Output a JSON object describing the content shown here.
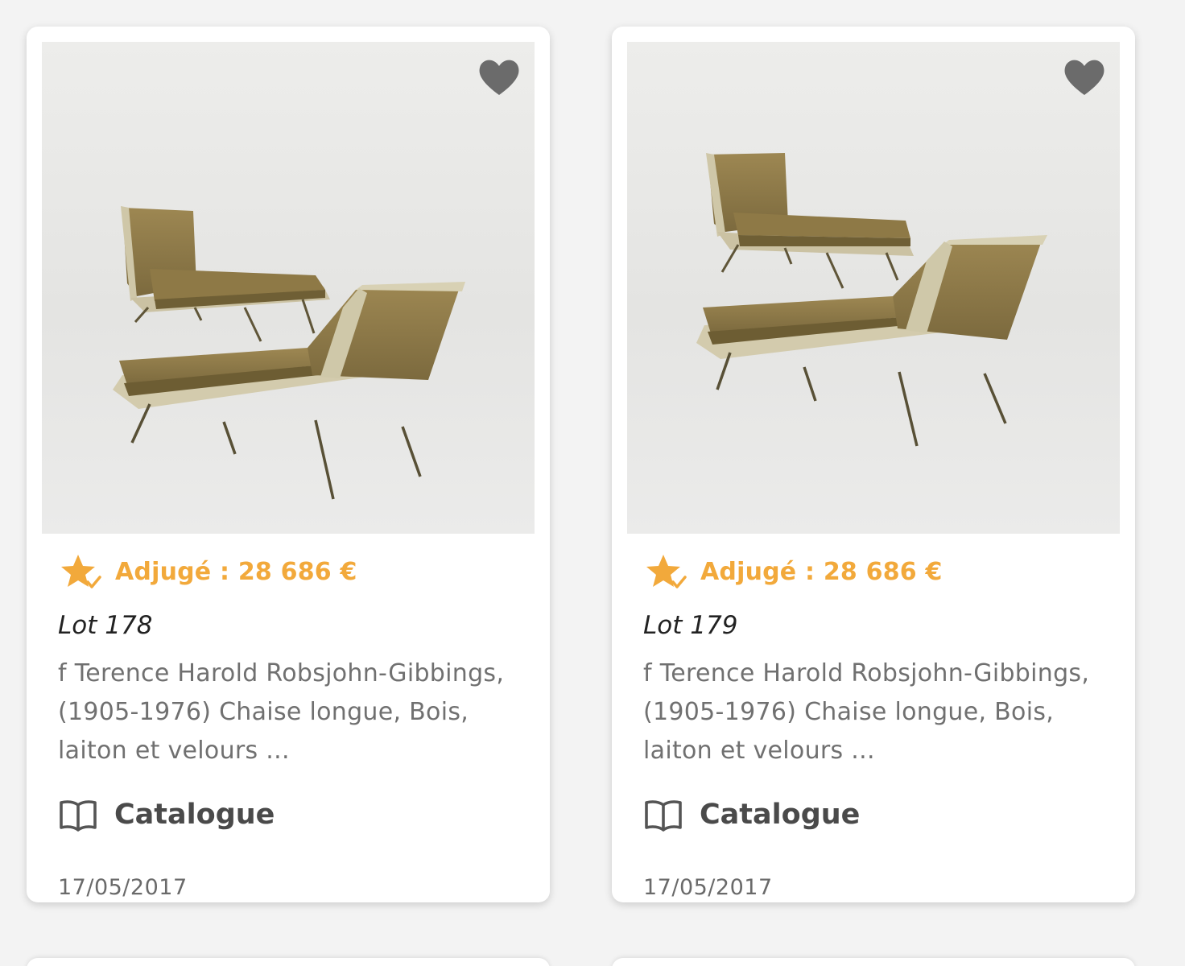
{
  "accent_color": "#f2a93b",
  "icons": {
    "favorite": "heart-icon",
    "sold": "star-check-icon",
    "catalogue": "book-open-icon"
  },
  "lots": [
    {
      "price": "Adjugé : 28 686 €",
      "lot_prefix": "Lot ",
      "lot_number": "178",
      "description": "f Terence Harold Robsjohn-Gibbings, (1905-1976)  Chaise longue, Bois, laiton et velours ...",
      "catalogue_label": "Catalogue",
      "date": "17/05/2017",
      "image_alt": "Deux chaises longues en velours sur pieds en laiton"
    },
    {
      "price": "Adjugé : 28 686 €",
      "lot_prefix": "Lot ",
      "lot_number": "179",
      "description": "f Terence Harold Robsjohn-Gibbings, (1905-1976)  Chaise longue, Bois, laiton et velours ...",
      "catalogue_label": "Catalogue",
      "date": "17/05/2017",
      "image_alt": "Deux chaises longues en velours sur pieds en laiton"
    }
  ]
}
